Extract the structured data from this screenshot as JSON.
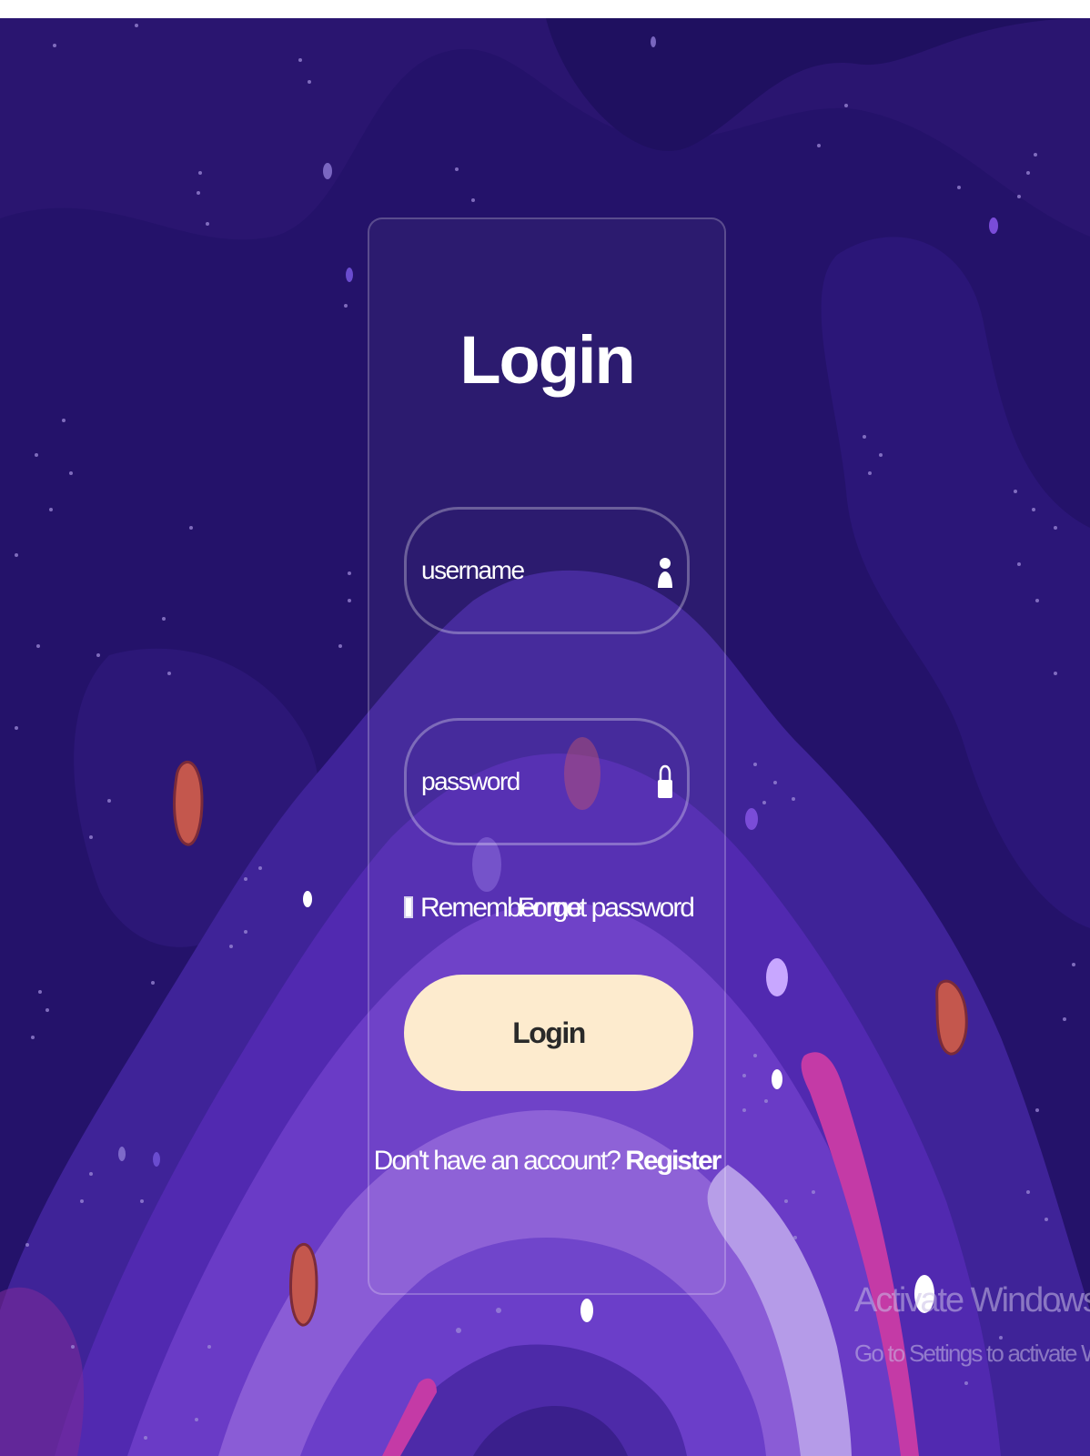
{
  "login": {
    "title": "Login",
    "username_placeholder": "username",
    "password_placeholder": "password",
    "remember_label": "Remember me",
    "forgot_label": "Forgot password",
    "button_label": "Login",
    "register_prompt": "Don't have an account?",
    "register_link": "Register"
  },
  "watermark": {
    "title": "Activate Windows",
    "subtitle": "Go to Settings to activate Windows."
  },
  "icons": {
    "username": "user-icon",
    "password": "lock-icon"
  },
  "colors": {
    "background": "#24126a",
    "button": "#fdebce",
    "button_text": "#2a2a2a",
    "text": "#ffffff"
  }
}
